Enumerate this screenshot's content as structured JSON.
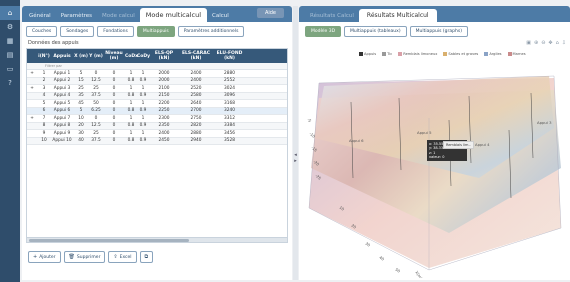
{
  "rail": {
    "icons": [
      "home-icon",
      "settings-icon",
      "grid-icon",
      "calculator-icon",
      "monitor-icon",
      "help-icon"
    ]
  },
  "left_panel": {
    "tabs": [
      {
        "label": "Général",
        "state": "normal"
      },
      {
        "label": "Paramètres",
        "state": "normal"
      },
      {
        "label": "Mode calcul",
        "state": "dim"
      },
      {
        "label": "Mode multicalcul",
        "state": "active"
      },
      {
        "label": "Calcul",
        "state": "normal"
      }
    ],
    "aide_label": "Aide",
    "subtabs": [
      {
        "label": "Couches",
        "active": false
      },
      {
        "label": "Sondages",
        "active": false
      },
      {
        "label": "Fondations",
        "active": false
      },
      {
        "label": "Multiappuis",
        "active": true
      },
      {
        "label": "Paramètres additionnels",
        "active": false
      }
    ],
    "section_title": "Données des appuis",
    "grid": {
      "headers": [
        "",
        "i(N°)",
        "Appuis",
        "X (m)",
        "Y (m)",
        "Niveau (m)",
        "CoDx",
        "CoDy",
        "ELS-QP (kN)",
        "ELS-CARAC (kN)",
        "ELU-FOND (kN)"
      ],
      "filter_hint": "Filtrer par",
      "rows": [
        [
          "+",
          "1",
          "Appui 1",
          "5",
          "0",
          "0",
          "1",
          "1",
          "2000",
          "2400",
          "2880"
        ],
        [
          "",
          "2",
          "Appui 2",
          "15",
          "12.5",
          "0",
          "0.8",
          "0.9",
          "2000",
          "2400",
          "2552"
        ],
        [
          "+",
          "3",
          "Appui 3",
          "25",
          "25",
          "0",
          "1",
          "1",
          "2100",
          "2520",
          "3024"
        ],
        [
          "",
          "4",
          "Appui 4",
          "35",
          "37.5",
          "0",
          "0.8",
          "0.9",
          "2150",
          "2580",
          "3096"
        ],
        [
          "",
          "5",
          "Appui 5",
          "45",
          "50",
          "0",
          "1",
          "1",
          "2200",
          "2640",
          "3168"
        ],
        [
          "",
          "6",
          "Appui 6",
          "5",
          "6.25",
          "0",
          "0.8",
          "0.9",
          "2250",
          "2700",
          "3240"
        ],
        [
          "+",
          "7",
          "Appui 7",
          "10",
          "0",
          "0",
          "1",
          "1",
          "2300",
          "2750",
          "3312"
        ],
        [
          "",
          "8",
          "Appui 8",
          "20",
          "12.5",
          "0",
          "0.8",
          "0.9",
          "2350",
          "2820",
          "3384"
        ],
        [
          "",
          "9",
          "Appui 9",
          "30",
          "25",
          "0",
          "1",
          "1",
          "2400",
          "2880",
          "3456"
        ],
        [
          "",
          "10",
          "Appui 10",
          "40",
          "37.5",
          "0",
          "0.8",
          "0.9",
          "2450",
          "2940",
          "3528"
        ]
      ],
      "highlight_row": 5
    },
    "buttons": [
      {
        "label": "Ajouter",
        "icon": "plus-icon",
        "glyph": "+"
      },
      {
        "label": "Supprimer",
        "icon": "trash-icon",
        "glyph": "🗑"
      },
      {
        "label": "Excel",
        "icon": "upload-icon",
        "glyph": "⇪"
      },
      {
        "label": "",
        "icon": "copy-icon",
        "glyph": "⧉"
      }
    ],
    "splitter_glyph": "◂ ▸"
  },
  "right_panel": {
    "tabs": [
      {
        "label": "Résultats Calcul",
        "active": false
      },
      {
        "label": "Résultats Multicalcul",
        "active": true
      }
    ],
    "subtabs": [
      {
        "label": "Modèle 3D",
        "active": true
      },
      {
        "label": "Multiappuis (tableaux)",
        "active": false
      },
      {
        "label": "Multiappuis (graphs)",
        "active": false
      }
    ],
    "toolbar_icons": [
      {
        "name": "camera-icon",
        "glyph": "▣"
      },
      {
        "name": "zoom-in-icon",
        "glyph": "⊕"
      },
      {
        "name": "zoom-out-icon",
        "glyph": "⊖"
      },
      {
        "name": "pan-icon",
        "glyph": "✥"
      },
      {
        "name": "home-icon",
        "glyph": "⌂"
      },
      {
        "name": "download-icon",
        "glyph": "⇩"
      }
    ],
    "legend": [
      {
        "label": "Appuis",
        "color": "#333333"
      },
      {
        "label": "Tic",
        "color": "#999999"
      },
      {
        "label": "Remblais limoneux",
        "color": "#d9a0a8"
      },
      {
        "label": "Sables et graves",
        "color": "#d9b06e"
      },
      {
        "label": "Argiles",
        "color": "#8aa3c6"
      },
      {
        "label": "Marnes",
        "color": "#c98b8b"
      }
    ],
    "tooltip": {
      "lines": [
        "x: 35.5556",
        "y: 38.3333",
        "z: 1",
        "valeur: 0"
      ],
      "name": "Remblais lim.."
    },
    "plot_labels": {
      "appui_labels": [
        "Appui 6",
        "Appui 5",
        "Appui 4",
        "Appui 3"
      ],
      "axis_ticks": [
        "10",
        "20",
        "30",
        "40",
        "50"
      ],
      "axis_z": [
        "-5",
        "-10",
        "-15",
        "-20",
        "-25"
      ],
      "axis_title": "X(m)"
    }
  },
  "colors": {
    "rail": "#2f4d6b",
    "tab_bar": "#4d7ba6",
    "grid_header": "#36597a",
    "active_subtab": "#7da57f"
  }
}
